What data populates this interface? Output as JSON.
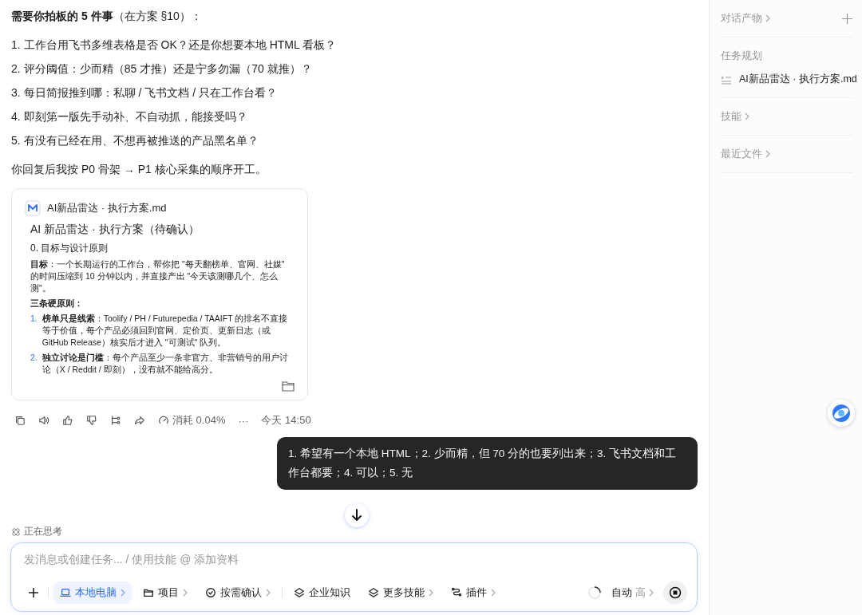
{
  "message": {
    "heading": "**需要你拍板的 5 件事**（在方案 §10）：",
    "items": [
      "工作台用飞书多维表格是否 OK？还是你想要本地 HTML 看板？",
      "评分阈值：少而精（85 才推）还是宁多勿漏（70 就推）？",
      "每日简报推到哪：私聊 / 飞书文档 / 只在工作台看？",
      "即刻第一版先手动补、不自动抓，能接受吗？",
      "有没有已经在用、不想再被推送的产品黑名单？"
    ],
    "item_numbers": [
      "1.",
      "2.",
      "3.",
      "4.",
      "5."
    ],
    "closing": "你回复后我按 P0 骨架 → P1 核心采集的顺序开工。"
  },
  "doc_card": {
    "file_name": "AI新品雷达 · 执行方案.md",
    "title": "AI 新品雷达 · 执行方案（待确认）",
    "section": "0. 目标与设计原则",
    "goal": "**目标**：一个长期运行的工作台，帮你把 \"每天翻榜单、官网、社媒\" 的时间压缩到 10 分钟以内，并直接产出 \"今天该测哪几个、怎么测\"。",
    "principles_label": "三条硬原则：",
    "principles": [
      {
        "number": "1.",
        "text": "**榜单只是线索**：Toolify / PH / Futurepedia / TAAIFT 的排名不直接等于价值，每个产品必须回到官网、定价页、更新日志（或 GitHub Release）核实后才进入 \"可测试\" 队列。"
      },
      {
        "number": "2.",
        "text": "**独立讨论是门槛**：每个产品至少一条非官方、非营销号的用户讨论（X / Reddit / 即刻），没有就不能给高分。"
      }
    ]
  },
  "actions": {
    "usage": "消耗 0.04%",
    "more": "···",
    "time": "今天 14:50"
  },
  "reply": "1. 希望有一个本地 HTML；2. 少而精，但 70 分的也要列出来；3. 飞书文档和工作台都要；4. 可以；5. 无",
  "thinking": "正在思考",
  "composer": {
    "placeholder": "发消息或创建任务... / 使用技能 @ 添加资料",
    "tools": [
      {
        "label": "本地电脑",
        "kind": "device",
        "chevron": true,
        "selected": true
      },
      {
        "label": "项目",
        "kind": "project",
        "chevron": true,
        "selected": false
      },
      {
        "label": "按需确认",
        "kind": "confirm",
        "chevron": true,
        "selected": false
      },
      {
        "label": "企业知识",
        "kind": "knowledge",
        "chevron": false,
        "selected": false
      },
      {
        "label": "更多技能",
        "kind": "skills",
        "chevron": true,
        "selected": false
      },
      {
        "label": "插件",
        "kind": "plugin",
        "chevron": true,
        "selected": false
      }
    ],
    "mode": "自动",
    "level": "高"
  },
  "sidebar": {
    "sections": [
      {
        "title": "对话产物",
        "chevron": true,
        "add": true
      },
      {
        "title": "任务规划",
        "chevron": false,
        "add": false,
        "files": [
          "AI新品雷达 · 执行方案.md"
        ]
      },
      {
        "title": "技能",
        "chevron": true,
        "add": false
      },
      {
        "title": "最近文件",
        "chevron": true,
        "add": false
      }
    ]
  }
}
